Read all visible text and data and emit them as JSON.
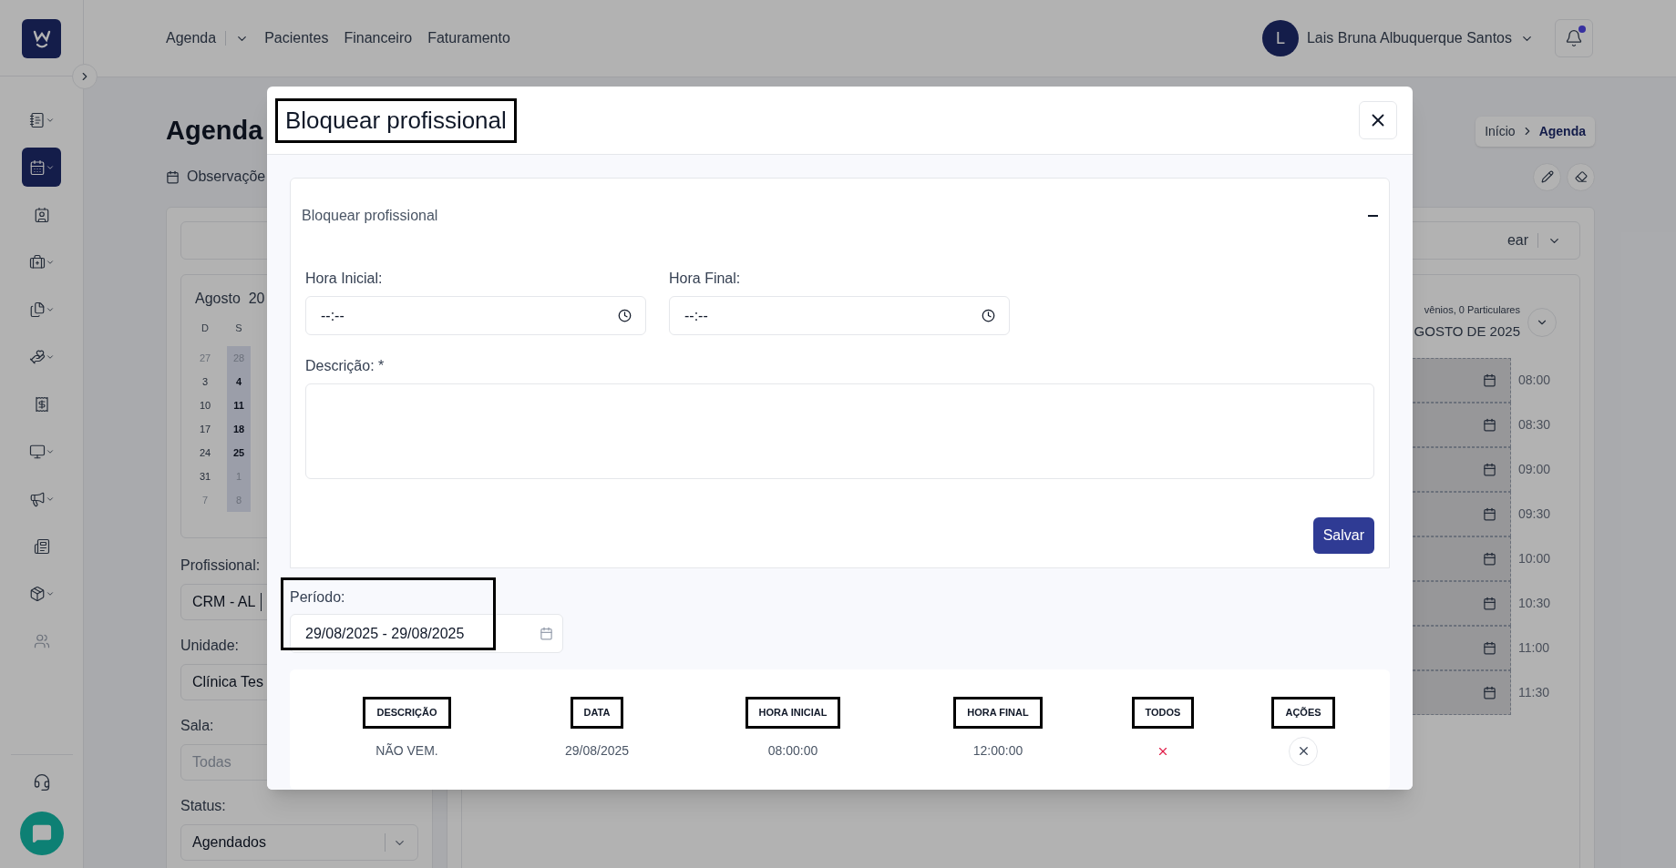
{
  "sidebar": {
    "items": [
      {
        "selected": false,
        "expandable": true
      },
      {
        "selected": true,
        "expandable": true
      },
      {
        "selected": false,
        "expandable": false
      },
      {
        "selected": false,
        "expandable": true
      },
      {
        "selected": false,
        "expandable": true
      },
      {
        "selected": false,
        "expandable": true
      },
      {
        "selected": false,
        "expandable": false
      },
      {
        "selected": false,
        "expandable": true
      },
      {
        "selected": false,
        "expandable": true
      },
      {
        "selected": false,
        "expandable": false
      },
      {
        "selected": false,
        "expandable": true
      },
      {
        "selected": false,
        "expandable": false
      }
    ]
  },
  "header": {
    "nav": [
      {
        "label": "Agenda",
        "dropdown": true
      },
      {
        "label": "Pacientes",
        "dropdown": false
      },
      {
        "label": "Financeiro",
        "dropdown": false
      },
      {
        "label": "Faturamento",
        "dropdown": false
      }
    ],
    "user": {
      "initial": "L",
      "name": "Lais Bruna Albuquerque Santos"
    },
    "notifications": {
      "unread": true
    }
  },
  "page": {
    "title": "Agenda",
    "observation": "Observaçõe",
    "breadcrumb": [
      "Início",
      "Agenda"
    ]
  },
  "filters": {
    "calendar": {
      "month": "Agosto  20",
      "weekdays": [
        {
          "label": "D",
          "highlighted": false
        },
        {
          "label": "S",
          "highlighted": true
        }
      ],
      "weeks": [
        [
          {
            "day": "27",
            "outside": true
          },
          {
            "day": "28",
            "outside": true
          }
        ],
        [
          {
            "day": "3",
            "outside": false
          },
          {
            "day": "4",
            "outside": false
          }
        ],
        [
          {
            "day": "10",
            "outside": false
          },
          {
            "day": "11",
            "outside": false
          }
        ],
        [
          {
            "day": "17",
            "outside": false
          },
          {
            "day": "18",
            "outside": false
          }
        ],
        [
          {
            "day": "24",
            "outside": false
          },
          {
            "day": "25",
            "outside": false
          }
        ],
        [
          {
            "day": "31",
            "outside": false
          },
          {
            "day": "1",
            "outside": true
          }
        ],
        [
          {
            "day": "7",
            "outside": true
          },
          {
            "day": "8",
            "outside": true
          }
        ]
      ]
    },
    "fields": [
      {
        "label": "Profissional:",
        "value": "CRM - AL",
        "kind": "select"
      },
      {
        "label": "Unidade:",
        "value": "Clínica Tes",
        "kind": "input"
      },
      {
        "label": "Sala:",
        "placeholder": "Todas",
        "kind": "input"
      },
      {
        "label": "Status:",
        "value": "Agendados",
        "kind": "select"
      }
    ]
  },
  "schedule": {
    "action_button": "ear",
    "summary": "vênios, 0 Particulares",
    "date": "GOSTO DE 2025",
    "slots": [
      "08:00",
      "08:30",
      "09:00",
      "09:30",
      "10:00",
      "10:30",
      "11:00",
      "11:30"
    ]
  },
  "modal": {
    "title": "Bloquear profissional",
    "title_annotated": true,
    "section": {
      "title": "Bloquear profissional",
      "expanded": true,
      "start": {
        "label": "Hora Inicial:",
        "placeholder": "--:--"
      },
      "end": {
        "label": "Hora Final:",
        "placeholder": "--:--"
      },
      "description": {
        "label": "Descrição: *"
      },
      "save": "Salvar"
    },
    "period": {
      "label": "Período:",
      "value": "29/08/2025 - 29/08/2025",
      "annotated": true
    },
    "table": {
      "columns": [
        {
          "label": "DESCRIÇÃO",
          "annotated": true
        },
        {
          "label": "DATA",
          "annotated": true
        },
        {
          "label": "HORA INICIAL",
          "annotated": true
        },
        {
          "label": "HORA FINAL",
          "annotated": true
        },
        {
          "label": "TODOS",
          "annotated": true
        },
        {
          "label": "AÇÕES",
          "annotated": true
        }
      ],
      "rows": [
        {
          "description": "NÃO VEM.",
          "date": "29/08/2025",
          "start": "08:00:00",
          "end": "12:00:00",
          "all": false
        }
      ]
    }
  }
}
